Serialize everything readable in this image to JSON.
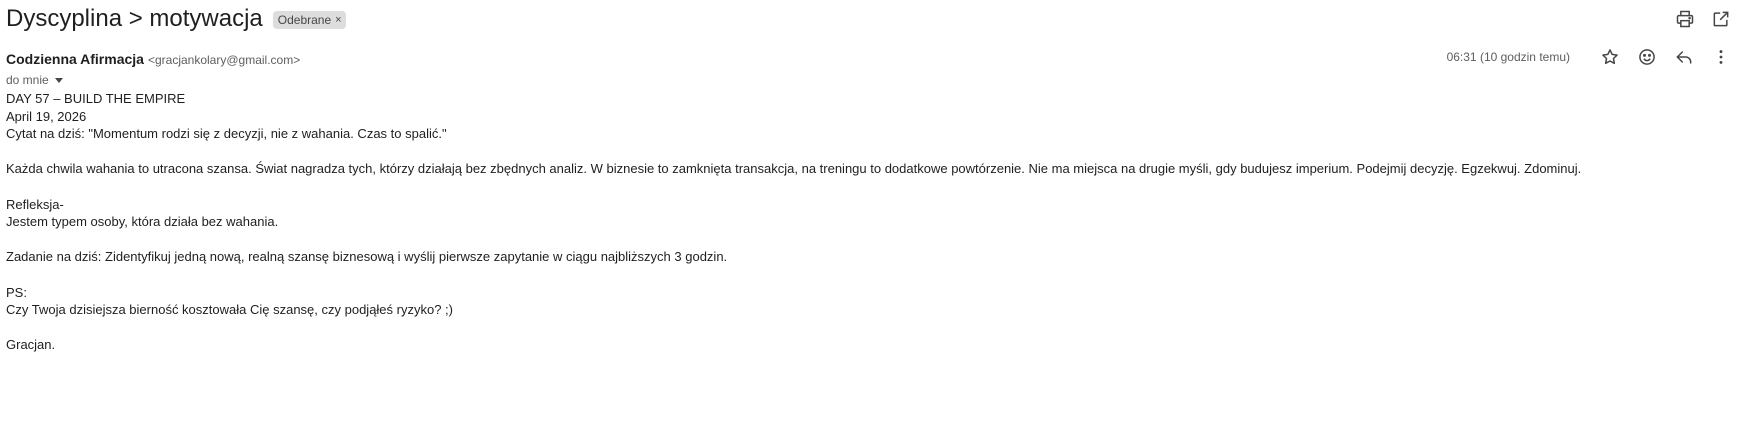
{
  "subject": {
    "title": "Dyscyplina > motywacja",
    "label": "Odebrane",
    "label_remove": "×"
  },
  "toolbar": {
    "print_icon": "print-icon",
    "popout_icon": "open-in-new-window-icon"
  },
  "message": {
    "sender_name": "Codzienna Afirmacja",
    "sender_email": "<gracjankolary@gmail.com>",
    "recipient": "do mnie",
    "timestamp": "06:31 (10 godzin temu)",
    "actions": [
      "star-icon",
      "emoji-reaction-icon",
      "reply-icon",
      "more-vert-icon"
    ]
  },
  "body": {
    "line1": "DAY 57 – BUILD THE EMPIRE",
    "line2": "April 19, 2026",
    "line3": "Cytat na dziś: \"Momentum rodzi się z decyzji, nie z wahania. Czas to spalić.\"",
    "paragraph1": "Każda chwila wahania to utracona szansa. Świat nagradza tych, którzy działają bez zbędnych analiz. W biznesie to zamknięta transakcja, na treningu to dodatkowe powtórzenie. Nie ma miejsca na drugie myśli, gdy budujesz imperium. Podejmij decyzję. Egzekwuj. Zdominuj.",
    "reflection_title": "Refleksja-",
    "reflection_text": "Jestem typem osoby, która działa bez wahania.",
    "task": "Zadanie na dziś: Zidentyfikuj jedną nową, realną szansę biznesową i wyślij pierwsze zapytanie w ciągu najbliższych 3 godzin.",
    "ps_title": "PS:",
    "ps_text": "Czy Twoja dzisiejsza bierność kosztowała Cię szansę, czy podjąłeś ryzyko? ;)",
    "signature": "Gracjan."
  }
}
